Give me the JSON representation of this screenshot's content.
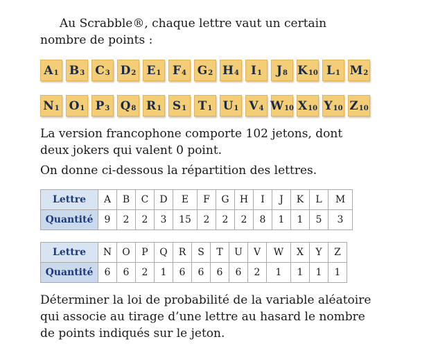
{
  "intro": {
    "text": "Au Scrabble®, chaque lettre vaut un certain nombre de points :"
  },
  "tiles_row1": [
    {
      "letter": "A",
      "points": "1"
    },
    {
      "letter": "B",
      "points": "3"
    },
    {
      "letter": "C",
      "points": "3"
    },
    {
      "letter": "D",
      "points": "2"
    },
    {
      "letter": "E",
      "points": "1"
    },
    {
      "letter": "F",
      "points": "4"
    },
    {
      "letter": "G",
      "points": "2"
    },
    {
      "letter": "H",
      "points": "4"
    },
    {
      "letter": "I",
      "points": "1"
    },
    {
      "letter": "J",
      "points": "8"
    },
    {
      "letter": "K",
      "points": "10"
    },
    {
      "letter": "L",
      "points": "1"
    },
    {
      "letter": "M",
      "points": "2"
    }
  ],
  "tiles_row2": [
    {
      "letter": "N",
      "points": "1"
    },
    {
      "letter": "O",
      "points": "1"
    },
    {
      "letter": "P",
      "points": "3"
    },
    {
      "letter": "Q",
      "points": "8"
    },
    {
      "letter": "R",
      "points": "1"
    },
    {
      "letter": "S",
      "points": "1"
    },
    {
      "letter": "T",
      "points": "1"
    },
    {
      "letter": "U",
      "points": "1"
    },
    {
      "letter": "V",
      "points": "4"
    },
    {
      "letter": "W",
      "points": "10"
    },
    {
      "letter": "X",
      "points": "10"
    },
    {
      "letter": "Y",
      "points": "10"
    },
    {
      "letter": "Z",
      "points": "10"
    }
  ],
  "paragraph2": "La version francophone comporte 102 jetons, dont deux jokers qui valent 0 point.",
  "paragraph3": "On donne ci-dessous la répartition des lettres.",
  "table1": {
    "row_header_letter": "Lettre",
    "row_header_qty": "Quantité",
    "letters": [
      "A",
      "B",
      "C",
      "D",
      "E",
      "F",
      "G",
      "H",
      "I",
      "J",
      "K",
      "L",
      "M"
    ],
    "quantities": [
      "9",
      "2",
      "2",
      "3",
      "15",
      "2",
      "2",
      "2",
      "8",
      "1",
      "1",
      "5",
      "3"
    ]
  },
  "table2": {
    "row_header_letter": "Lettre",
    "row_header_qty": "Quantité",
    "letters": [
      "N",
      "O",
      "P",
      "Q",
      "R",
      "S",
      "T",
      "U",
      "V",
      "W",
      "X",
      "Y",
      "Z"
    ],
    "quantities": [
      "6",
      "6",
      "2",
      "1",
      "6",
      "6",
      "6",
      "6",
      "2",
      "1",
      "1",
      "1",
      "1"
    ]
  },
  "question": "Déterminer la loi de probabilité de la variable aléatoire qui associe au tirage d’une lettre au hasard le nombre de points indiqués sur le jeton."
}
